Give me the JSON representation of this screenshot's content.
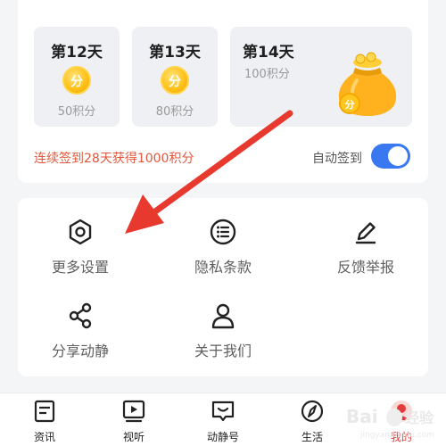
{
  "checkin": {
    "days": [
      {
        "title": "第12天",
        "coin": "分",
        "points": "50积分"
      },
      {
        "title": "第13天",
        "coin": "分",
        "points": "80积分"
      },
      {
        "title": "第14天",
        "coin": "分",
        "points": "100积分"
      }
    ],
    "streak_text": "连续签到28天获得1000积分",
    "auto_label": "自动签到",
    "auto_enabled": true
  },
  "settings": {
    "items": [
      {
        "label": "更多设置",
        "icon": "hexagon-settings-icon"
      },
      {
        "label": "隐私条款",
        "icon": "list-circle-icon"
      },
      {
        "label": "反馈举报",
        "icon": "pencil-icon"
      },
      {
        "label": "分享动静",
        "icon": "share-icon"
      },
      {
        "label": "关于我们",
        "icon": "person-icon"
      }
    ]
  },
  "tabbar": {
    "tabs": [
      {
        "label": "资讯",
        "icon": "news-icon"
      },
      {
        "label": "视听",
        "icon": "video-icon"
      },
      {
        "label": "动静号",
        "icon": "chat-face-icon"
      },
      {
        "label": "生活",
        "icon": "compass-icon"
      },
      {
        "label": "我的",
        "icon": "profile-icon",
        "active": true
      }
    ]
  },
  "colors": {
    "accent_blue": "#3a78f2",
    "streak_red": "#e2573b",
    "active_tab_red": "#e23b3b",
    "arrow_red": "#e8392f"
  }
}
